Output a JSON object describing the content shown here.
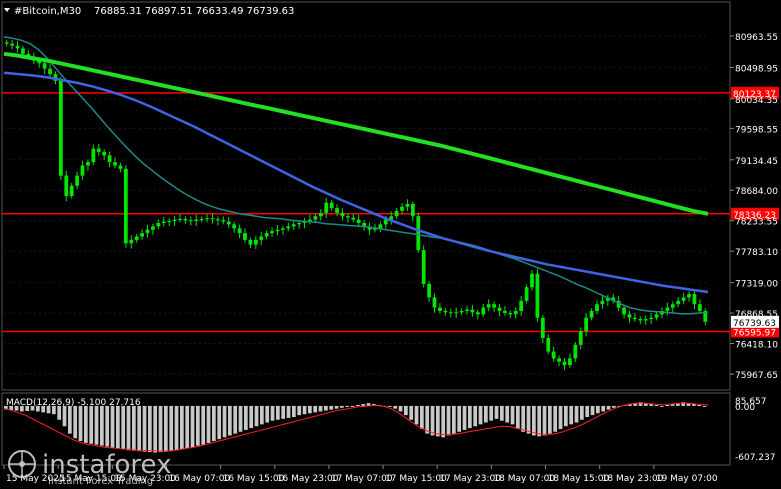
{
  "header": {
    "symbol_label": "#Bitcoin,M30",
    "ohlc": "76885.31 76897.51 76633.49 76739.63"
  },
  "macd_label": "MACD(12,26,9) -5.100 27.716",
  "watermark": {
    "brand": "instaforex",
    "tagline": "Instant Forex Trading"
  },
  "colors": {
    "background": "#000000",
    "grid": "#1a1a1a",
    "candle": "#00e600",
    "ma_fast": "#1f8a8a",
    "ma_mid": "#3f64e6",
    "ma_slow": "#22e022",
    "level": "#ff0000",
    "macd_hist": "#c8c8c8",
    "macd_signal": "#ff2020"
  },
  "price_axis": [
    "80963.55",
    "80498.95",
    "80034.35",
    "79598.55",
    "79134.45",
    "78684.00",
    "78233.55",
    "77783.10",
    "77319.00",
    "76868.55",
    "76418.10",
    "75967.65"
  ],
  "levels": [
    {
      "price": 80123.37,
      "label": "80123.37"
    },
    {
      "price": 78336.23,
      "label": "78336.23"
    },
    {
      "price": 76595.97,
      "label": "76595.97"
    }
  ],
  "current_price": {
    "price": 76739.63,
    "label": "76739.63"
  },
  "macd_axis": [
    "85.657",
    "0.00",
    "-607.237"
  ],
  "time_axis": [
    "15 May 2025",
    "15 May 15:00",
    "15 May 23:00",
    "16 May 07:00",
    "16 May 15:00",
    "16 May 23:00",
    "17 May 07:00",
    "17 May 15:00",
    "17 May 23:00",
    "18 May 07:00",
    "18 May 15:00",
    "18 May 23:00",
    "19 May 07:00"
  ],
  "chart_data": {
    "type": "candlestick",
    "symbol": "#Bitcoin",
    "timeframe": "M30",
    "ylim": [
      75850,
      81200
    ],
    "close_series": [
      80850,
      80820,
      80780,
      80700,
      80650,
      80600,
      80560,
      80480,
      80400,
      80300,
      78900,
      78600,
      78750,
      78900,
      79050,
      79100,
      79300,
      79250,
      79200,
      79100,
      79050,
      79000,
      77900,
      77950,
      78000,
      78050,
      78100,
      78150,
      78200,
      78220,
      78230,
      78250,
      78260,
      78240,
      78230,
      78250,
      78260,
      78270,
      78255,
      78240,
      78220,
      78180,
      78120,
      78050,
      77950,
      77880,
      77950,
      78000,
      78050,
      78080,
      78100,
      78120,
      78150,
      78180,
      78200,
      78220,
      78250,
      78300,
      78350,
      78500,
      78420,
      78350,
      78300,
      78280,
      78250,
      78200,
      78150,
      78100,
      78120,
      78180,
      78250,
      78300,
      78380,
      78440,
      78480,
      78300,
      77800,
      77300,
      77100,
      76950,
      76900,
      76880,
      76870,
      76880,
      76900,
      76920,
      76880,
      76850,
      76950,
      77000,
      76950,
      76900,
      76870,
      76850,
      76900,
      77050,
      77250,
      77450,
      76800,
      76500,
      76300,
      76200,
      76150,
      76100,
      76200,
      76400,
      76600,
      76800,
      76900,
      77000,
      77050,
      77100,
      77050,
      76950,
      76850,
      76800,
      76780,
      76760,
      76780,
      76800,
      76850,
      76900,
      76950,
      77000,
      77050,
      77100,
      77150,
      77000,
      76900,
      76739.63
    ],
    "ma_fast": [
      80950,
      80930,
      80900,
      80850,
      80760,
      80630,
      80480,
      80330,
      80190,
      80050,
      79910,
      79760,
      79610,
      79470,
      79330,
      79200,
      79080,
      78980,
      78880,
      78790,
      78700,
      78620,
      78550,
      78490,
      78440,
      78400,
      78370,
      78340,
      78320,
      78300,
      78280,
      78270,
      78260,
      78240,
      78230,
      78220,
      78210,
      78190,
      78180,
      78170,
      78160,
      78150,
      78140,
      78120,
      78100,
      78080,
      78060,
      78040,
      78020,
      78000,
      77980,
      77960,
      77930,
      77900,
      77870,
      77830,
      77790,
      77740,
      77700,
      77660,
      77610,
      77560,
      77510,
      77460,
      77410,
      77350,
      77290,
      77240,
      77180,
      77120,
      77060,
      77000,
      76950,
      76920,
      76900,
      76890,
      76880,
      76870,
      76860,
      76860,
      76870,
      76880
    ],
    "ma_mid": [
      80420,
      80400,
      80380,
      80350,
      80310,
      80270,
      80220,
      80160,
      80090,
      80010,
      79920,
      79820,
      79720,
      79620,
      79510,
      79400,
      79290,
      79180,
      79070,
      78960,
      78850,
      78740,
      78640,
      78540,
      78450,
      78360,
      78270,
      78190,
      78110,
      78040,
      77970,
      77910,
      77850,
      77790,
      77740,
      77690,
      77640,
      77590,
      77550,
      77510,
      77470,
      77430,
      77390,
      77350,
      77310,
      77270,
      77240,
      77210,
      77180
    ],
    "ma_slow": [
      80700,
      80670,
      80630,
      80590,
      80540,
      80490,
      80440,
      80390,
      80340,
      80290,
      80240,
      80190,
      80140,
      80090,
      80040,
      79990,
      79940,
      79890,
      79840,
      79790,
      79740,
      79690,
      79640,
      79590,
      79540,
      79490,
      79440,
      79390,
      79340,
      79280,
      79220,
      79160,
      79100,
      79040,
      78980,
      78920,
      78860,
      78800,
      78740,
      78680,
      78620,
      78560,
      78500,
      78440,
      78380,
      78336
    ],
    "macd_hist": [
      -40,
      -45,
      -50,
      -60,
      -55,
      -50,
      -60,
      -70,
      -80,
      -90,
      -150,
      -220,
      -300,
      -350,
      -380,
      -400,
      -410,
      -420,
      -430,
      -440,
      -450,
      -460,
      -470,
      -480,
      -485,
      -490,
      -495,
      -500,
      -505,
      -500,
      -495,
      -490,
      -480,
      -470,
      -460,
      -450,
      -430,
      -420,
      -400,
      -380,
      -360,
      -340,
      -320,
      -300,
      -280,
      -260,
      -240,
      -220,
      -200,
      -180,
      -160,
      -150,
      -140,
      -130,
      -120,
      -100,
      -90,
      -80,
      -70,
      -60,
      -50,
      -40,
      -30,
      -20,
      -10,
      0,
      10,
      20,
      30,
      20,
      10,
      0,
      -10,
      -30,
      -60,
      -100,
      -150,
      -200,
      -250,
      -300,
      -320,
      -330,
      -340,
      -320,
      -300,
      -280,
      -260,
      -240,
      -220,
      -200,
      -180,
      -160,
      -140,
      -160,
      -180,
      -200,
      -250,
      -280,
      -300,
      -320,
      -330,
      -320,
      -300,
      -280,
      -250,
      -220,
      -200,
      -180,
      -150,
      -120,
      -100,
      -80,
      -60,
      -40,
      -20,
      0,
      10,
      20,
      30,
      40,
      30,
      20,
      10,
      0,
      10,
      20,
      30,
      40,
      30,
      20,
      10,
      0
    ],
    "macd_signal": [
      -30,
      -40,
      -60,
      -80,
      -100,
      -130,
      -160,
      -190,
      -220,
      -250,
      -280,
      -310,
      -340,
      -370,
      -390,
      -410,
      -420,
      -430,
      -440,
      -450,
      -455,
      -460,
      -465,
      -470,
      -475,
      -480,
      -482,
      -484,
      -486,
      -488,
      -490,
      -485,
      -478,
      -470,
      -460,
      -450,
      -440,
      -425,
      -410,
      -395,
      -380,
      -365,
      -350,
      -335,
      -320,
      -305,
      -290,
      -275,
      -260,
      -245,
      -230,
      -215,
      -200,
      -185,
      -170,
      -155,
      -140,
      -125,
      -110,
      -95,
      -80,
      -65,
      -50,
      -40,
      -30,
      -20,
      -10,
      -5,
      0,
      5,
      0,
      -10,
      -30,
      -60,
      -100,
      -140,
      -180,
      -220,
      -250,
      -275,
      -295,
      -305,
      -310,
      -310,
      -305,
      -295,
      -285,
      -275,
      -265,
      -255,
      -245,
      -235,
      -225,
      -220,
      -225,
      -235,
      -250,
      -265,
      -280,
      -295,
      -305,
      -310,
      -305,
      -295,
      -280,
      -260,
      -240,
      -215,
      -190,
      -160,
      -130,
      -100,
      -70,
      -45,
      -20,
      0,
      15,
      25,
      30,
      30,
      25,
      20,
      15,
      15,
      20,
      25,
      30,
      30,
      25,
      20,
      15,
      10
    ],
    "macd_range": [
      -607.237,
      85.657
    ]
  }
}
